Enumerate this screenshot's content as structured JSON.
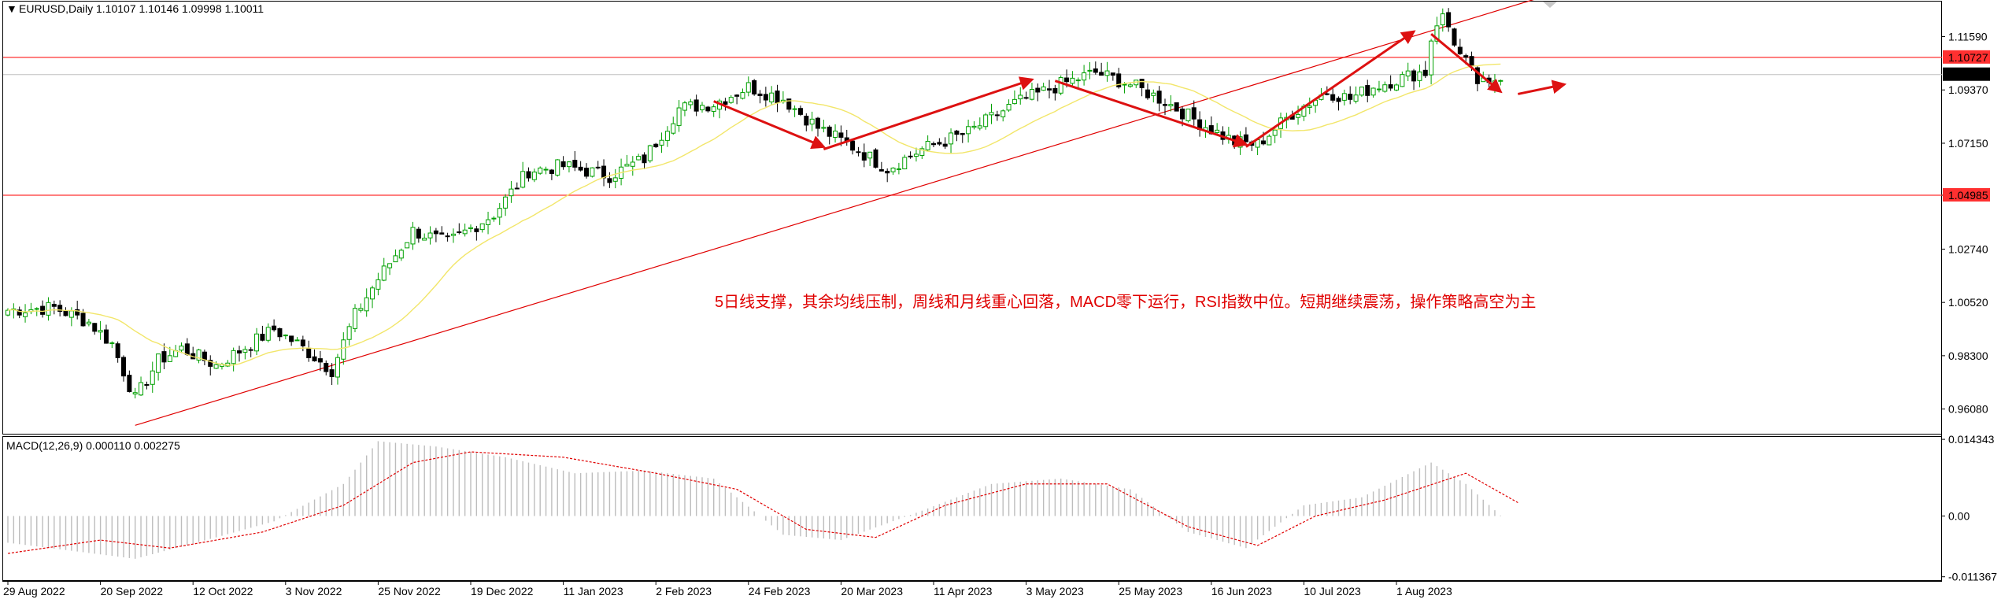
{
  "header": {
    "symbol": "EURUSD,Daily",
    "ohlc": "1.10107 1.10146 1.09998 1.10011"
  },
  "macd_header": "MACD(12,26,9) 0.000110 0.002275",
  "annotation": "5日线支撑，其余均线压制，周线和月线重心回落，MACD零下运行，RSI指数中位。短期继续震荡，操作策略高空为主",
  "colors": {
    "bull": "#00a000",
    "bear": "#000000",
    "ma": "#f2e66a",
    "trend": "#e00000",
    "level": "#ff3030",
    "price_line": "#c0c0c0",
    "macd_hist": "#bdbdbd",
    "signal": "#e00000",
    "arrow": "#dd1111",
    "annotation": "#e00000"
  },
  "chart_data": [
    {
      "type": "candlestick",
      "title": "EURUSD,Daily",
      "ylim": [
        0.9505,
        1.1305
      ],
      "price_ticks": [
        "1.11590",
        "1.09370",
        "1.07150",
        "1.04985",
        "1.02740",
        "1.00520",
        "0.98300",
        "0.96080"
      ],
      "x_tick_labels": [
        "29 Aug 2022",
        "20 Sep 2022",
        "12 Oct 2022",
        "3 Nov 2022",
        "25 Nov 2022",
        "19 Dec 2022",
        "11 Jan 2023",
        "2 Feb 2023",
        "24 Feb 2023",
        "20 Mar 2023",
        "11 Apr 2023",
        "3 May 2023",
        "25 May 2023",
        "16 Jun 2023",
        "10 Jul 2023",
        "1 Aug 2023"
      ],
      "num_bars": 245,
      "anchors": [
        {
          "bar": 0,
          "close": 1.002
        },
        {
          "bar": 8,
          "close": 1.003
        },
        {
          "bar": 14,
          "close": 0.997
        },
        {
          "bar": 18,
          "close": 0.988
        },
        {
          "bar": 22,
          "close": 0.965
        },
        {
          "bar": 26,
          "close": 0.981
        },
        {
          "bar": 30,
          "close": 0.986
        },
        {
          "bar": 36,
          "close": 0.979
        },
        {
          "bar": 40,
          "close": 0.985
        },
        {
          "bar": 46,
          "close": 0.994
        },
        {
          "bar": 50,
          "close": 0.988
        },
        {
          "bar": 56,
          "close": 0.977
        },
        {
          "bar": 60,
          "close": 1.0
        },
        {
          "bar": 64,
          "close": 1.015
        },
        {
          "bar": 70,
          "close": 1.035
        },
        {
          "bar": 76,
          "close": 1.03
        },
        {
          "bar": 84,
          "close": 1.042
        },
        {
          "bar": 90,
          "close": 1.06
        },
        {
          "bar": 96,
          "close": 1.062
        },
        {
          "bar": 104,
          "close": 1.058
        },
        {
          "bar": 110,
          "close": 1.065
        },
        {
          "bar": 116,
          "close": 1.086
        },
        {
          "bar": 122,
          "close": 1.088
        },
        {
          "bar": 128,
          "close": 1.095
        },
        {
          "bar": 134,
          "close": 1.09
        },
        {
          "bar": 140,
          "close": 1.078
        },
        {
          "bar": 146,
          "close": 1.07
        },
        {
          "bar": 152,
          "close": 1.061
        },
        {
          "bar": 158,
          "close": 1.069
        },
        {
          "bar": 166,
          "close": 1.076
        },
        {
          "bar": 174,
          "close": 1.088
        },
        {
          "bar": 182,
          "close": 1.096
        },
        {
          "bar": 188,
          "close": 1.101
        },
        {
          "bar": 194,
          "close": 1.096
        },
        {
          "bar": 200,
          "close": 1.089
        },
        {
          "bar": 206,
          "close": 1.08
        },
        {
          "bar": 212,
          "close": 1.072
        },
        {
          "bar": 216,
          "close": 1.071
        },
        {
          "bar": 222,
          "close": 1.084
        },
        {
          "bar": 228,
          "close": 1.093
        },
        {
          "bar": 232,
          "close": 1.09
        },
        {
          "bar": 236,
          "close": 1.095
        },
        {
          "bar": 244,
          "close": 1.101
        }
      ],
      "extra_bars": [
        {
          "close": 1.101
        },
        {
          "close": 1.115
        },
        {
          "close": 1.122
        },
        {
          "close": 1.124
        },
        {
          "close": 1.12
        },
        {
          "close": 1.114
        },
        {
          "close": 1.108
        },
        {
          "close": 1.105
        },
        {
          "close": 1.101
        },
        {
          "close": 1.097
        },
        {
          "close": 1.096
        },
        {
          "close": 1.095
        },
        {
          "close": 1.098
        },
        {
          "close": 1.1001
        }
      ],
      "levels": [
        {
          "label": "1.10727",
          "value": 1.10727
        },
        {
          "label": "1.04985",
          "value": 1.04985
        }
      ],
      "current_price": {
        "label": "1.10011",
        "value": 1.10011
      },
      "trendline": {
        "from": [
          22,
          0.954
        ],
        "to": [
          266,
          1.133
        ]
      },
      "arrows": [
        {
          "from": [
            122,
            1.089
          ],
          "to": [
            141,
            1.07
          ]
        },
        {
          "from": [
            141,
            1.069
          ],
          "to": [
            177,
            1.098
          ]
        },
        {
          "from": [
            181,
            1.0975
          ],
          "to": [
            214,
            1.071
          ]
        },
        {
          "from": [
            214,
            1.07
          ],
          "to": [
            243,
            1.118
          ]
        },
        {
          "from": [
            246,
            1.117
          ],
          "to": [
            258,
            1.093
          ]
        },
        {
          "from": [
            261,
            1.092
          ],
          "to": [
            269,
            1.096
          ]
        }
      ]
    },
    {
      "type": "bar+line",
      "title": "MACD(12,26,9)",
      "ylim": [
        -0.012,
        0.0148
      ],
      "y_ticks": [
        "0.014343",
        "0.00",
        "-0.011367"
      ],
      "hist_anchors": [
        {
          "bar": 0,
          "value": -0.005
        },
        {
          "bar": 22,
          "value": -0.008
        },
        {
          "bar": 36,
          "value": -0.004
        },
        {
          "bar": 46,
          "value": -0.001
        },
        {
          "bar": 58,
          "value": 0.006
        },
        {
          "bar": 64,
          "value": 0.014
        },
        {
          "bar": 74,
          "value": 0.013
        },
        {
          "bar": 86,
          "value": 0.011
        },
        {
          "bar": 98,
          "value": 0.008
        },
        {
          "bar": 110,
          "value": 0.0085
        },
        {
          "bar": 122,
          "value": 0.007
        },
        {
          "bar": 134,
          "value": -0.0035
        },
        {
          "bar": 144,
          "value": -0.0045
        },
        {
          "bar": 158,
          "value": 0.001
        },
        {
          "bar": 170,
          "value": 0.006
        },
        {
          "bar": 182,
          "value": 0.007
        },
        {
          "bar": 194,
          "value": 0.005
        },
        {
          "bar": 204,
          "value": -0.003
        },
        {
          "bar": 214,
          "value": -0.006
        },
        {
          "bar": 224,
          "value": 0.002
        },
        {
          "bar": 234,
          "value": 0.0035
        },
        {
          "bar": 246,
          "value": 0.01
        },
        {
          "bar": 252,
          "value": 0.006
        },
        {
          "bar": 258,
          "value": 0.0001
        }
      ],
      "signal_anchors": [
        {
          "bar": 0,
          "value": -0.007
        },
        {
          "bar": 16,
          "value": -0.0045
        },
        {
          "bar": 28,
          "value": -0.006
        },
        {
          "bar": 44,
          "value": -0.003
        },
        {
          "bar": 58,
          "value": 0.002
        },
        {
          "bar": 70,
          "value": 0.01
        },
        {
          "bar": 80,
          "value": 0.012
        },
        {
          "bar": 96,
          "value": 0.011
        },
        {
          "bar": 112,
          "value": 0.008
        },
        {
          "bar": 126,
          "value": 0.005
        },
        {
          "bar": 138,
          "value": -0.0025
        },
        {
          "bar": 150,
          "value": -0.004
        },
        {
          "bar": 162,
          "value": 0.002
        },
        {
          "bar": 176,
          "value": 0.006
        },
        {
          "bar": 190,
          "value": 0.006
        },
        {
          "bar": 204,
          "value": -0.002
        },
        {
          "bar": 216,
          "value": -0.0055
        },
        {
          "bar": 226,
          "value": 0.0
        },
        {
          "bar": 238,
          "value": 0.003
        },
        {
          "bar": 252,
          "value": 0.008
        },
        {
          "bar": 261,
          "value": 0.0025
        }
      ]
    }
  ]
}
